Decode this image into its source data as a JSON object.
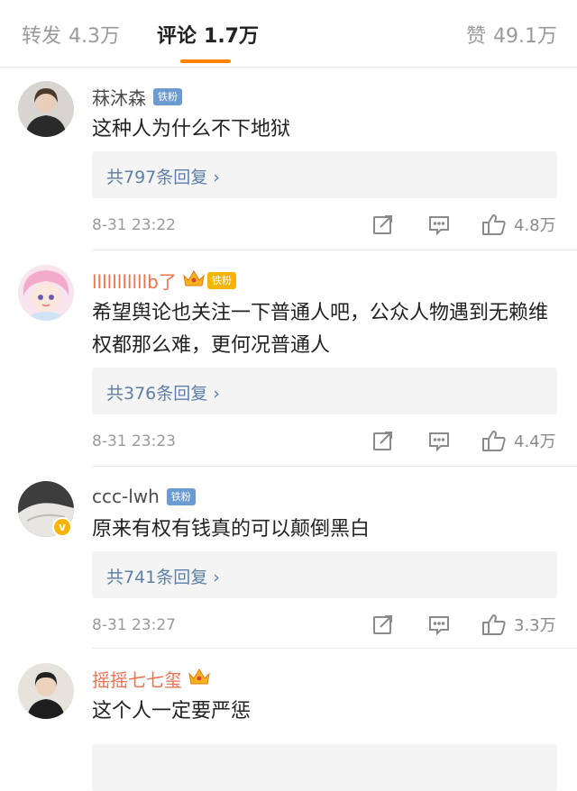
{
  "tabs": {
    "repost": {
      "label": "转发",
      "count": "4.3万"
    },
    "comment": {
      "label": "评论",
      "count": "1.7万"
    },
    "like": {
      "label": "赞",
      "count": "49.1万"
    }
  },
  "colors": {
    "accent": "#ff8200",
    "link": "#5d7fa8",
    "vip_name": "#eb7350",
    "fan_badge": "#6c9bd2"
  },
  "comments": [
    {
      "name": "菻沐森",
      "badge": "铁粉",
      "text": "这种人为什么不下地狱",
      "replies": "共797条回复 ›",
      "time": "8-31 23:22",
      "likes": "4.8万"
    },
    {
      "name": "lllllllllllb了",
      "badge": "铁粉",
      "text": "希望舆论也关注一下普通人吧，公众人物遇到无赖维权都那么难，更何况普通人",
      "replies": "共376条回复 ›",
      "time": "8-31 23:23",
      "likes": "4.4万"
    },
    {
      "name": "ccc-lwh",
      "badge": "铁粉",
      "text": "原来有权有钱真的可以颠倒黑白",
      "replies": "共741条回复 ›",
      "time": "8-31 23:27",
      "likes": "3.3万"
    },
    {
      "name": "摇摇七七玺",
      "text": "这个人一定要严惩"
    }
  ]
}
